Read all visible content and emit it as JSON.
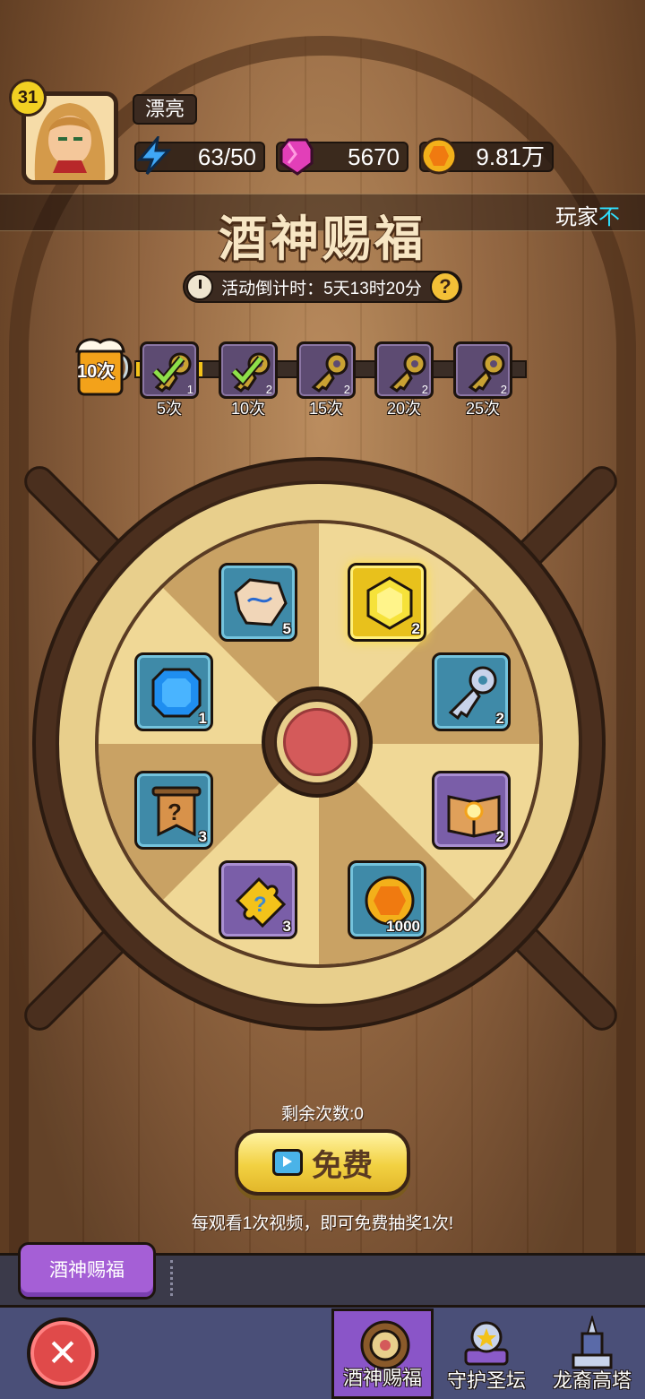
{
  "player": {
    "level": "31",
    "name": "漂亮",
    "energy": "63/50",
    "gems": "5670",
    "gold": "9.81万"
  },
  "marquee": {
    "prefix": "玩家",
    "highlight": "不"
  },
  "event": {
    "title": "酒神赐福",
    "countdown": "活动倒计时：5天13时20分",
    "help": "?"
  },
  "progress": {
    "current_label": "10次",
    "fill_fraction": 0.17,
    "milestones": [
      {
        "label": "5次",
        "count": "1",
        "claimed": true
      },
      {
        "label": "10次",
        "count": "2",
        "claimed": true
      },
      {
        "label": "15次",
        "count": "2",
        "claimed": false
      },
      {
        "label": "20次",
        "count": "2",
        "claimed": false
      },
      {
        "label": "25次",
        "count": "2",
        "claimed": false
      }
    ]
  },
  "wheel": {
    "prizes": [
      {
        "name": "rune-stone-icon",
        "qty": "5",
        "style": "blue"
      },
      {
        "name": "gold-gem-icon",
        "qty": "2",
        "style": "gold"
      },
      {
        "name": "silver-key-icon",
        "qty": "2",
        "style": "blue"
      },
      {
        "name": "magic-book-icon",
        "qty": "2",
        "style": "purple"
      },
      {
        "name": "gold-coin-icon",
        "qty": "1000",
        "style": "blue"
      },
      {
        "name": "puzzle-piece-icon",
        "qty": "3",
        "style": "purple"
      },
      {
        "name": "mystery-scroll-icon",
        "qty": "3",
        "style": "blue"
      },
      {
        "name": "blue-gem-icon",
        "qty": "1",
        "style": "blue"
      }
    ]
  },
  "action": {
    "remaining": "剩余次数:0",
    "free_label": "免费",
    "hint": "每观看1次视频，即可免费抽奖1次!"
  },
  "tabs": {
    "subtab": "酒神赐福",
    "nav": [
      {
        "label": "酒神赐福",
        "icon": "wheel-icon",
        "active": true
      },
      {
        "label": "守护圣坛",
        "icon": "altar-icon",
        "active": false
      },
      {
        "label": "龙裔高塔",
        "icon": "tower-icon",
        "active": false
      }
    ]
  },
  "colors": {
    "accent_gold": "#f3c21a",
    "active_tab": "#8a55c8",
    "close_red": "#e04a4a"
  }
}
